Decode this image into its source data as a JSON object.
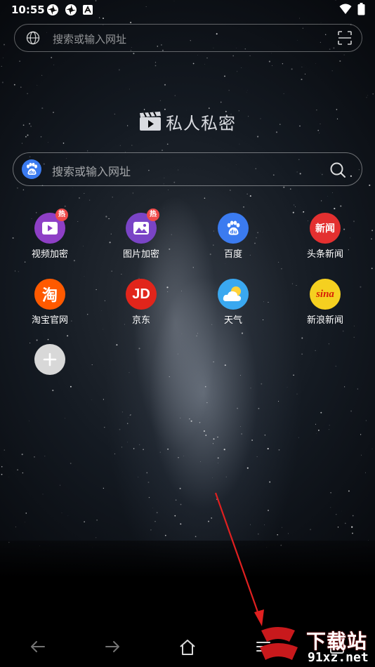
{
  "status_bar": {
    "time": "10:55",
    "notification_icons": [
      "pinwheel-icon",
      "pinwheel-icon",
      "app-a-icon"
    ],
    "system_icons": [
      "wifi-icon",
      "battery-icon"
    ]
  },
  "top_search": {
    "placeholder": "搜索或输入网址",
    "left_icon": "globe-icon",
    "right_icon": "scan-icon"
  },
  "brand": {
    "title": "私人私密",
    "icon": "clapperboard-icon"
  },
  "main_search": {
    "placeholder": "搜索或输入网址",
    "engine_icon": "baidu-paw-icon",
    "button_icon": "magnifier-icon"
  },
  "hot_badge": "热",
  "shortcuts": [
    {
      "label": "视频加密",
      "icon": "video-lock-icon",
      "color": "#8e3fc6",
      "hot": true
    },
    {
      "label": "图片加密",
      "icon": "image-lock-icon",
      "color": "#7a44c6",
      "hot": true
    },
    {
      "label": "百度",
      "icon": "baidu-icon",
      "color": "#3b7bf0",
      "hot": false
    },
    {
      "label": "头条新闻",
      "icon": "toutiao-icon",
      "color": "#e33030",
      "hot": false,
      "icon_text": "新闻"
    },
    {
      "label": "淘宝官网",
      "icon": "taobao-icon",
      "color": "#ff5a00",
      "hot": false,
      "icon_text": "淘"
    },
    {
      "label": "京东",
      "icon": "jd-icon",
      "color": "#e1251b",
      "hot": false,
      "icon_text": "JD"
    },
    {
      "label": "天气",
      "icon": "weather-icon",
      "color": "#3aa8f0",
      "hot": false
    },
    {
      "label": "新浪新闻",
      "icon": "sina-icon",
      "color": "#f5d020",
      "hot": false,
      "icon_text": "sina"
    }
  ],
  "add_button": {
    "icon": "plus-icon"
  },
  "nav_bar": {
    "items": [
      "back-arrow-icon",
      "forward-arrow-icon",
      "home-icon",
      "menu-icon",
      "tabs-icon"
    ],
    "tab_count": "1"
  },
  "watermark": {
    "text_top": "下载站",
    "text_bottom": "91xz.net",
    "logo": "9"
  },
  "colors": {
    "annotation_arrow": "#e02020",
    "accent_blue": "#3b7bf0"
  }
}
